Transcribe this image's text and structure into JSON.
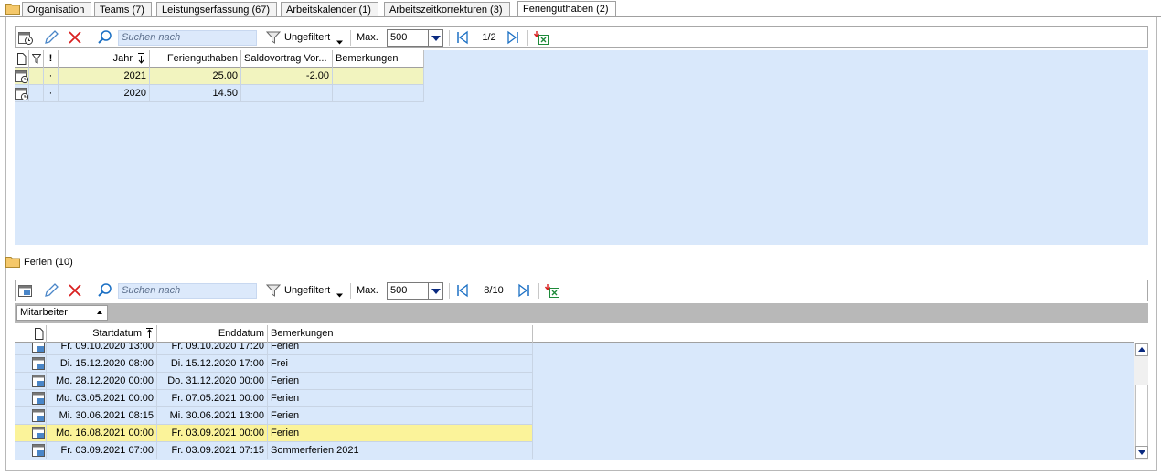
{
  "tabs": [
    {
      "label": "Organisation"
    },
    {
      "label": "Teams (7)"
    },
    {
      "label": "Leistungserfassung (67)"
    },
    {
      "label": "Arbeitskalender (1)"
    },
    {
      "label": "Arbeitszeitkorrekturen (3)"
    },
    {
      "label": "Ferienguthaben (2)",
      "active": true
    }
  ],
  "toolbar_top": {
    "search_placeholder": "Suchen nach",
    "filter_label": "Ungefiltert",
    "max_label": "Max.",
    "max_value": "500",
    "page": "1/2"
  },
  "grid_top": {
    "columns": {
      "doc": "",
      "filter": "",
      "excl": "!",
      "jahr": "Jahr",
      "guthaben": "Ferienguthaben",
      "saldo": "Saldovortrag Vor...",
      "bemerkungen": "Bemerkungen"
    },
    "rows": [
      {
        "dot": "·",
        "jahr": "2021",
        "guthaben": "25.00",
        "saldo": "-2.00",
        "bemerkungen": ""
      },
      {
        "dot": "·",
        "jahr": "2020",
        "guthaben": "14.50",
        "saldo": "",
        "bemerkungen": ""
      }
    ]
  },
  "section_ferien": {
    "label": "Ferien (10)"
  },
  "toolbar_bottom": {
    "search_placeholder": "Suchen nach",
    "filter_label": "Ungefiltert",
    "max_label": "Max.",
    "max_value": "500",
    "page": "8/10"
  },
  "group_by": {
    "label": "Mitarbeiter"
  },
  "grid_bottom": {
    "columns": {
      "start": "Startdatum",
      "end": "Enddatum",
      "bemerkungen": "Bemerkungen"
    },
    "rows": [
      {
        "start": "Fr. 09.10.2020 13:00",
        "end": "Fr. 09.10.2020 17:20",
        "bemerkungen": "Ferien"
      },
      {
        "start": "Di. 15.12.2020 08:00",
        "end": "Di. 15.12.2020 17:00",
        "bemerkungen": "Frei"
      },
      {
        "start": "Mo. 28.12.2020 00:00",
        "end": "Do. 31.12.2020 00:00",
        "bemerkungen": "Ferien"
      },
      {
        "start": "Mo. 03.05.2021 00:00",
        "end": "Fr. 07.05.2021 00:00",
        "bemerkungen": "Ferien"
      },
      {
        "start": "Mi. 30.06.2021 08:15",
        "end": "Mi. 30.06.2021 13:00",
        "bemerkungen": "Ferien"
      },
      {
        "start": "Mo. 16.08.2021 00:00",
        "end": "Fr. 03.09.2021 00:00",
        "bemerkungen": "Ferien"
      },
      {
        "start": "Fr. 03.09.2021 07:00",
        "end": "Fr. 03.09.2021 07:15",
        "bemerkungen": "Sommerferien 2021"
      }
    ]
  },
  "colors": {
    "grid_bg": "#d9e8fb",
    "selected_row": "#f2f4bf",
    "highlight_row": "#fbf39a",
    "delete_red": "#d92020",
    "accent_blue": "#1a6fc4"
  },
  "icons": {
    "new_record": "calendar-clock-icon",
    "edit": "pencil-icon",
    "delete": "x-icon",
    "search": "magnifier-icon",
    "filter": "funnel-icon",
    "first": "first-page-icon",
    "last": "last-page-icon",
    "export": "excel-export-icon"
  }
}
